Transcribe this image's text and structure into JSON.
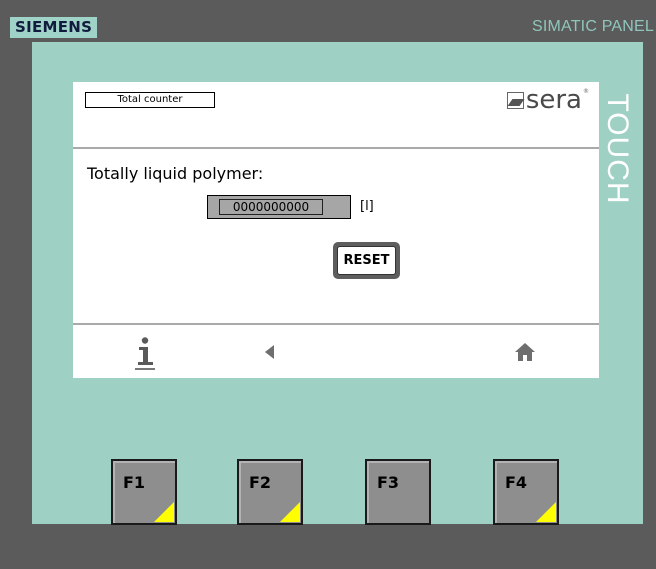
{
  "bezel": {
    "brand": "SIEMENS",
    "model": "SIMATIC PANEL",
    "vertical_label": "TOUCH"
  },
  "screen": {
    "title_box": "Total counter",
    "logo_text": "sera",
    "logo_reg": "®",
    "heading": "Totally liquid polymer:",
    "counter_value": "0000000000",
    "unit": "[l]",
    "reset_label": "RESET"
  },
  "nav": {
    "info_icon": "info-icon",
    "back_icon": "triangle-left-icon",
    "home_icon": "home-icon"
  },
  "function_keys": [
    "F1",
    "F2",
    "F3",
    "F4"
  ],
  "colors": {
    "frame": "#9fd0c4",
    "bezel": "#5b5b5b",
    "brand_text": "#101b3d",
    "key_corner": "#ffff00"
  }
}
